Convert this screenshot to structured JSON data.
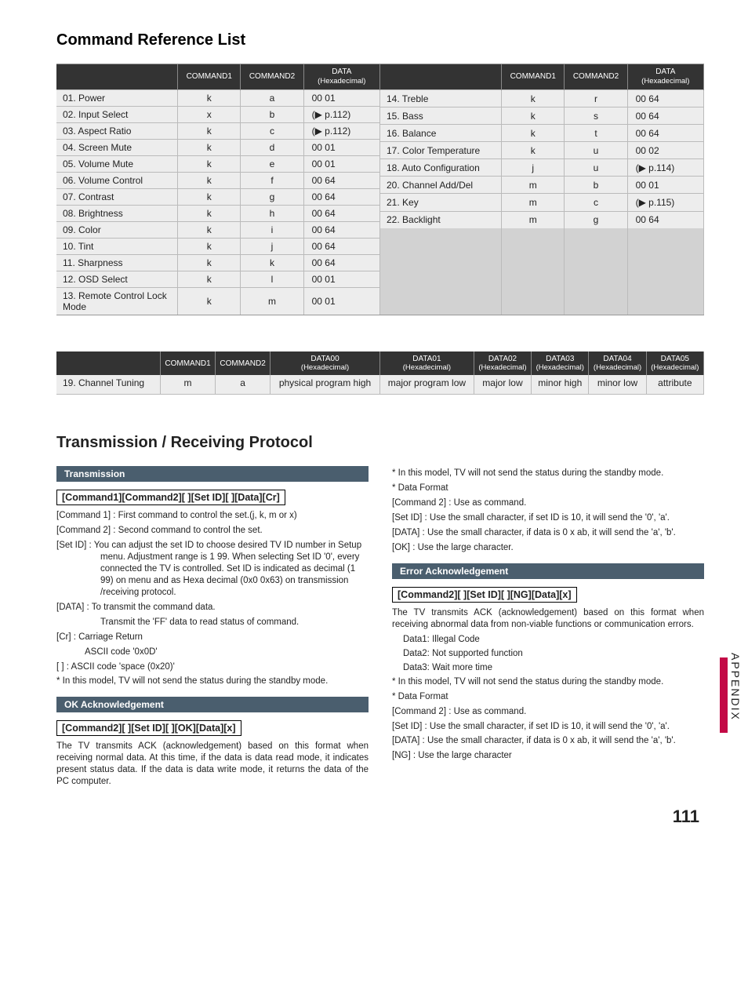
{
  "section1_title": "Command Reference List",
  "headers": {
    "cmd1": "COMMAND1",
    "cmd2": "COMMAND2",
    "data_top": "DATA",
    "data_sub": "(Hexadecimal)"
  },
  "left_rows": [
    {
      "label": "01. Power",
      "c1": "k",
      "c2": "a",
      "data": "00   01"
    },
    {
      "label": "02. Input Select",
      "c1": "x",
      "c2": "b",
      "data": "(▶ p.112)"
    },
    {
      "label": "03. Aspect Ratio",
      "c1": "k",
      "c2": "c",
      "data": "(▶ p.112)"
    },
    {
      "label": "04. Screen Mute",
      "c1": "k",
      "c2": "d",
      "data": "00   01"
    },
    {
      "label": "05. Volume Mute",
      "c1": "k",
      "c2": "e",
      "data": "00   01"
    },
    {
      "label": "06. Volume Control",
      "c1": "k",
      "c2": "f",
      "data": "00   64"
    },
    {
      "label": "07. Contrast",
      "c1": "k",
      "c2": "g",
      "data": "00   64"
    },
    {
      "label": "08. Brightness",
      "c1": "k",
      "c2": "h",
      "data": "00   64"
    },
    {
      "label": "09. Color",
      "c1": "k",
      "c2": "i",
      "data": "00   64"
    },
    {
      "label": "10. Tint",
      "c1": "k",
      "c2": "j",
      "data": "00   64"
    },
    {
      "label": "11. Sharpness",
      "c1": "k",
      "c2": "k",
      "data": "00   64"
    },
    {
      "label": "12. OSD Select",
      "c1": "k",
      "c2": "l",
      "data": "00   01"
    },
    {
      "label": "13. Remote Control Lock Mode",
      "c1": "k",
      "c2": "m",
      "data": "00   01"
    }
  ],
  "right_rows": [
    {
      "label": "14. Treble",
      "c1": "k",
      "c2": "r",
      "data": "00   64"
    },
    {
      "label": "15. Bass",
      "c1": "k",
      "c2": "s",
      "data": "00   64"
    },
    {
      "label": "16. Balance",
      "c1": "k",
      "c2": "t",
      "data": "00   64"
    },
    {
      "label": "17. Color Temperature",
      "c1": "k",
      "c2": "u",
      "data": "00   02"
    },
    {
      "label": "18. Auto Configuration",
      "c1": "j",
      "c2": "u",
      "data": "(▶ p.114)"
    },
    {
      "label": "20. Channel Add/Del",
      "c1": "m",
      "c2": "b",
      "data": "00   01"
    },
    {
      "label": "21. Key",
      "c1": "m",
      "c2": "c",
      "data": "(▶ p.115)"
    },
    {
      "label": "22. Backlight",
      "c1": "m",
      "c2": "g",
      "data": "00   64"
    }
  ],
  "tbl2_headers": [
    "COMMAND1",
    "COMMAND2",
    "DATA00",
    "DATA01",
    "DATA02",
    "DATA03",
    "DATA04",
    "DATA05"
  ],
  "tbl2_subhead": "(Hexadecimal)",
  "tbl2_row": {
    "label": "19. Channel Tuning",
    "cells": [
      "m",
      "a",
      "physical program high",
      "major program low",
      "major low",
      "minor high",
      "minor low",
      "attribute"
    ]
  },
  "section2_title": "Transmission / Receiving  Protocol",
  "trans": {
    "head": "Transmission",
    "cmd": "[Command1][Command2][  ][Set ID][  ][Data][Cr]",
    "l1": "[Command 1] : First command to control the set.(j, k, m or x)",
    "l2": "[Command 2] : Second command to control the set.",
    "l3": "[Set ID] : You can adjust the set ID to choose desired TV ID number in Setup menu. Adjustment range is 1   99. When selecting Set ID '0', every connected the TV is controlled. Set ID is indicated as decimal (1   99) on menu and as Hexa decimal (0x0   0x63) on transmission /receiving protocol.",
    "l4": "[DATA] : To transmit the command data.",
    "l4b": "Transmit the 'FF' data to read status of command.",
    "l5": "[Cr] : Carriage Return",
    "l5b": "ASCII code '0x0D'",
    "l6": "[  ] : ASCII code 'space (0x20)'",
    "l7": "* In this model, TV will not send the status during the standby mode."
  },
  "ok": {
    "head": "OK Acknowledgement",
    "cmd": "[Command2][  ][Set ID][  ][OK][Data][x]",
    "body": "The TV transmits ACK (acknowledgement) based on this format when receiving normal data. At this time, if the data is data read mode, it indicates present status data. If the data is data write mode, it returns the data of the PC computer."
  },
  "right_top_notes": {
    "n1": "* In this model, TV will not send the status during the standby mode.",
    "n2": "* Data Format",
    "n3": "[Command 2] : Use as command.",
    "n4": "[Set ID] : Use the small character, if set ID is 10, it will send the '0', 'a'.",
    "n5": "[DATA] : Use the small character, if data is 0 x ab, it will send the 'a', 'b'.",
    "n6": "[OK] : Use the large character."
  },
  "err": {
    "head": "Error Acknowledgement",
    "cmd": "[Command2][  ][Set ID][  ][NG][Data][x]",
    "body": "The TV transmits ACK (acknowledgement) based on this format when receiving abnormal data from non-viable functions or communication errors.",
    "d1": "Data1: Illegal Code",
    "d2": "Data2: Not supported function",
    "d3": "Data3: Wait more time",
    "n1": "* In this model, TV will not send the status during the standby mode.",
    "n2": "* Data Format",
    "n3": "[Command 2] : Use as command.",
    "n4": "[Set ID] : Use the small character, if set ID is 10, it will send the '0', 'a'.",
    "n5": "[DATA] : Use the small character, if data is 0 x ab, it will send the 'a', 'b'.",
    "n6": "[NG] : Use the large character"
  },
  "side_tab": "APPENDIX",
  "page_number": "111"
}
